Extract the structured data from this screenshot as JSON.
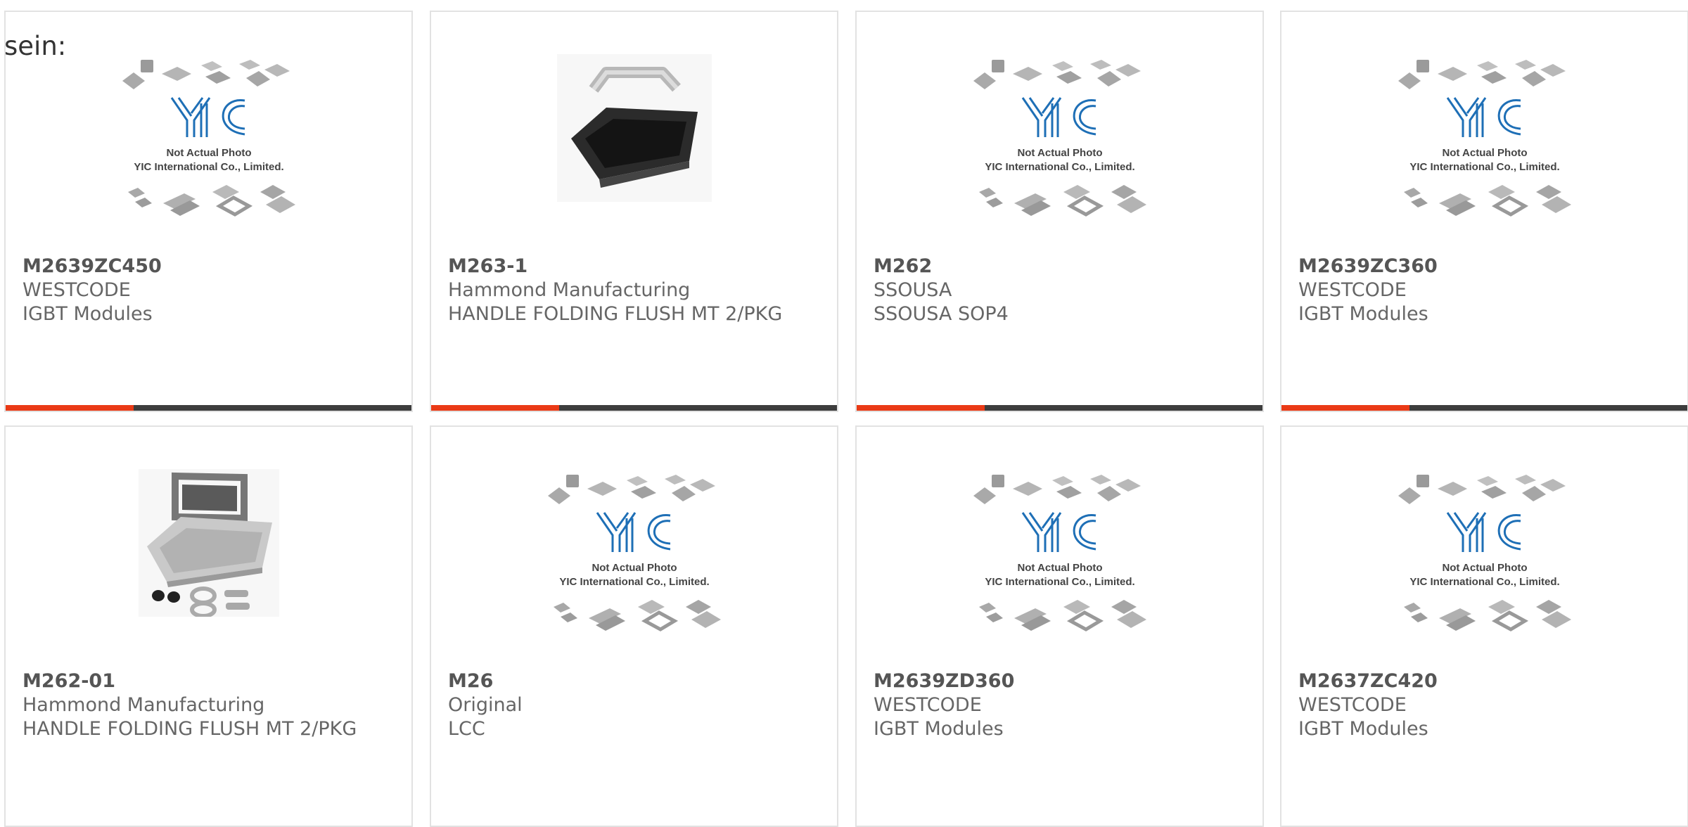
{
  "intro_text": "sein:",
  "colors": {
    "accent": "#ea3a16",
    "bar_dark": "#3d3d3d",
    "border": "#e2e2e2",
    "logo_blue": "#1e6fb6"
  },
  "products": [
    {
      "part": "M2639ZC450",
      "manufacturer": "WESTCODE",
      "description": "IGBT Modules",
      "image": "yic-placeholder"
    },
    {
      "part": "M263-1",
      "manufacturer": "Hammond Manufacturing",
      "description": "HANDLE FOLDING FLUSH MT 2/PKG",
      "image": "handle-photo"
    },
    {
      "part": "M262",
      "manufacturer": "SSOUSA",
      "description": "SSOUSA SOP4",
      "image": "yic-placeholder"
    },
    {
      "part": "M2639ZC360",
      "manufacturer": "WESTCODE",
      "description": "IGBT Modules",
      "image": "yic-placeholder"
    },
    {
      "part": "M262-01",
      "manufacturer": "Hammond Manufacturing",
      "description": "HANDLE FOLDING FLUSH MT 2/PKG",
      "image": "handle-kit-photo"
    },
    {
      "part": "M26",
      "manufacturer": "Original",
      "description": "LCC",
      "image": "yic-placeholder"
    },
    {
      "part": "M2639ZD360",
      "manufacturer": "WESTCODE",
      "description": "IGBT Modules",
      "image": "yic-placeholder"
    },
    {
      "part": "M2637ZC420",
      "manufacturer": "WESTCODE",
      "description": "IGBT Modules",
      "image": "yic-placeholder"
    }
  ],
  "placeholder": {
    "line1": "Not Actual Photo",
    "line2": "YIC International Co., Limited.",
    "logo_text": "YIC"
  }
}
